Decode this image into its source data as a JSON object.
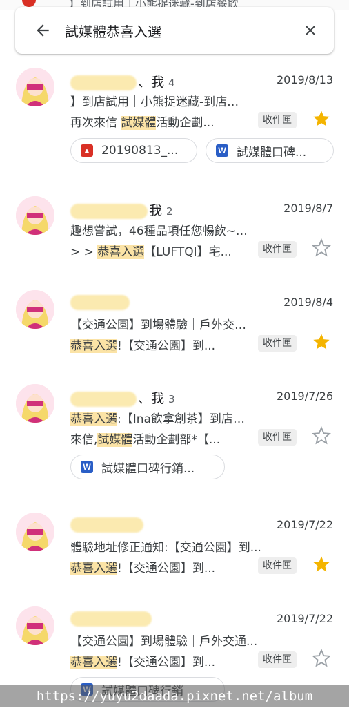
{
  "background_peek": {
    "text": "】到店試用｜小熊捉迷藏-到店餐飲"
  },
  "search": {
    "query": "試媒體恭喜入選"
  },
  "threads": [
    {
      "sender_me": "、我",
      "count": "4",
      "date": "2019/8/13",
      "line1": "】到店試用｜小熊捉迷藏-到店餐飲...",
      "line2_pre": "再次來信 ",
      "line2_hl": "試媒體",
      "line2_post": "活動企劃...",
      "label": "收件匣",
      "starred": true,
      "attachments": [
        {
          "type": "image",
          "name": "20190813_..."
        },
        {
          "type": "word",
          "name": "試媒體口碑..."
        }
      ]
    },
    {
      "sender_me": "我",
      "count": "2",
      "date": "2019/8/7",
      "line1": "趣想嘗試，46種品項任您暢飲~最...",
      "line2_pre": "> > ",
      "line2_hl": "恭喜入選",
      "line2_post": "【LUFTQI】宅...",
      "label": "收件匣",
      "starred": false
    },
    {
      "sender_me": "",
      "count": "",
      "date": "2019/8/4",
      "line1": "【交通公園】到場體驗｜戶外交通...",
      "line2_pre": "",
      "line2_hl": "恭喜入選",
      "line2_post": "!【交通公園】到...",
      "label": "收件匣",
      "starred": true
    },
    {
      "sender_me": "、我",
      "count": "3",
      "date": "2019/7/26",
      "line1_hl": "恭喜入選",
      "line1": ":【Ina飲拿創茶】到店體驗...",
      "line2_pre": "來信,",
      "line2_hl": "試媒體",
      "line2_post": "活動企劃部*【...",
      "label": "收件匣",
      "starred": false,
      "attachments": [
        {
          "type": "word",
          "name": "試媒體口碑行銷..."
        }
      ]
    },
    {
      "sender_me": "",
      "count": "",
      "date": "2019/7/22",
      "line1": "體驗地址修正通知:【交通公園】到...",
      "line2_pre": "",
      "line2_hl": "恭喜入選",
      "line2_post": "!【交通公園】到...",
      "label": "收件匣",
      "starred": true
    },
    {
      "sender_me": "",
      "count": "",
      "date": "2019/7/22",
      "line1": "【交通公園】到場體驗｜戶外交通...",
      "line2_pre": "",
      "line2_hl": "恭喜入選",
      "line2_post": "!【交通公園】到...",
      "label": "收件匣",
      "starred": false,
      "attachments": [
        {
          "type": "word",
          "name": "試媒體口碑行銷"
        }
      ]
    }
  ],
  "watermark": "https://yuyu2daada.pixnet.net/album",
  "colors": {
    "star_filled": "#f4b400",
    "star_outline": "#9aa0a6",
    "highlight": "#fbe3a6",
    "word_icon": "#2a5ec6",
    "image_icon": "#d93025"
  }
}
